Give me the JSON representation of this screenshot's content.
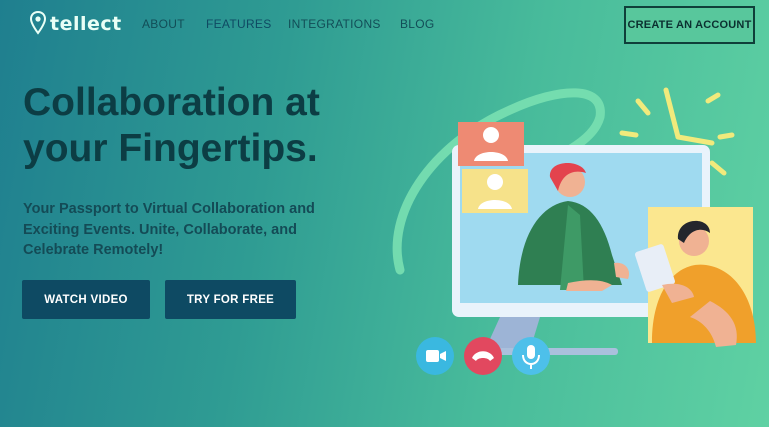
{
  "brand": {
    "name": "tellect"
  },
  "nav": {
    "links": [
      {
        "label": "ABOUT"
      },
      {
        "label": "FEATURES"
      },
      {
        "label": "INTEGRATIONS"
      },
      {
        "label": "BLOG"
      }
    ],
    "cta_label": "CREATE AN ACCOUNT"
  },
  "hero": {
    "title": "Collaboration at your Fingertips.",
    "subtitle": "Your Passport to Virtual Collaboration and Exciting Events. Unite, Collaborate, and Celebrate Remotely!",
    "primary_button": "WATCH VIDEO",
    "secondary_button": "TRY FOR FREE"
  },
  "call_controls": {
    "icons": [
      "video-camera-icon",
      "hang-up-icon",
      "microphone-icon"
    ]
  },
  "colors": {
    "primary": "#0e4a63",
    "background_start": "#1f7f8f",
    "background_end": "#5fd1a3",
    "hangup": "#e2485f",
    "camera": "#3ab8e0",
    "clock": "#f1ea7c"
  }
}
